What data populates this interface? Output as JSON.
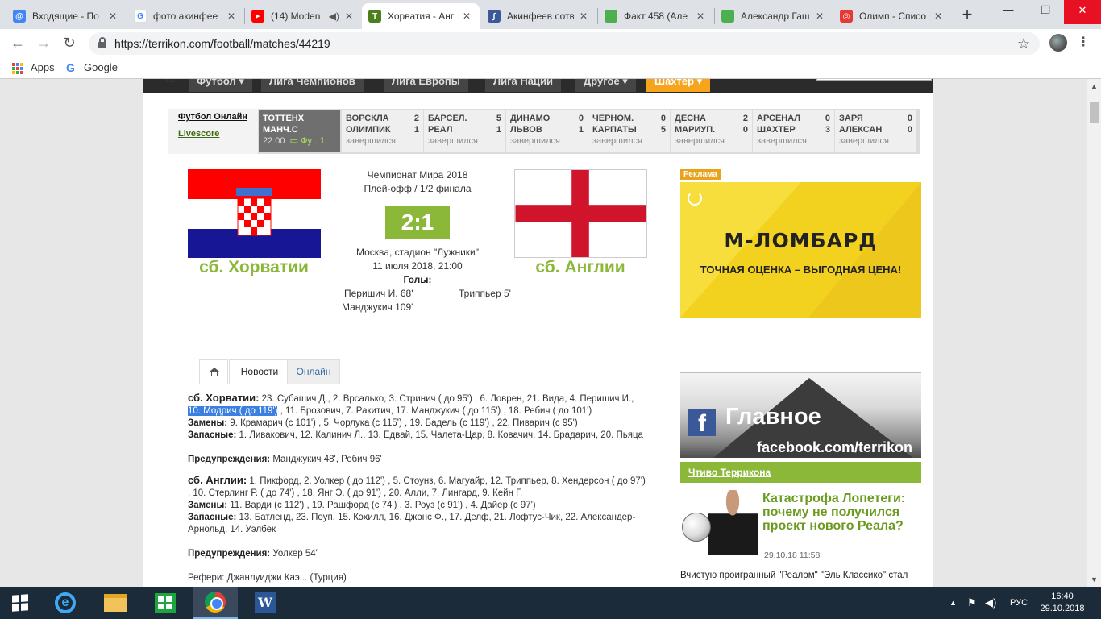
{
  "browser": {
    "tabs": [
      {
        "title": "Входящие - По",
        "icon_color": "#4285f4",
        "icon_char": "@"
      },
      {
        "title": "фото акинфее",
        "icon_color": "#ffffff",
        "icon_char": "G"
      },
      {
        "title": "(14) Moden",
        "icon_color": "#ff0000",
        "icon_char": "▶"
      },
      {
        "title": "Хорватия - Анг",
        "icon_color": "#4d7f1d",
        "icon_char": "T"
      },
      {
        "title": "Акинфеев сотв",
        "icon_color": "#3b5998",
        "icon_char": "∫"
      },
      {
        "title": "Факт 458 (Але",
        "icon_color": "#4caf50",
        "icon_char": ""
      },
      {
        "title": "Александр Гаш",
        "icon_color": "#4caf50",
        "icon_char": ""
      },
      {
        "title": "Олимп - Списо",
        "icon_color": "#e53935",
        "icon_char": "◎"
      }
    ],
    "url": "https://terrikon.com/football/matches/44219",
    "bookmarks": {
      "apps": "Apps",
      "google": "Google"
    }
  },
  "site": {
    "nav": [
      "Футбол ▾",
      "Лига Чемпионов",
      "Лига Европы",
      "Лига Наций",
      "Другое ▾",
      "Шахтер ▾"
    ]
  },
  "ticker": {
    "links": {
      "football_online": "Футбол Онлайн",
      "livescore": "Livescore"
    },
    "matches": [
      {
        "home": "ТОТТЕНХ",
        "away": "МАНЧ.С",
        "hs": "",
        "as": "",
        "status": "22:00",
        "live": "Фут. 1"
      },
      {
        "home": "ВОРСКЛА",
        "away": "ОЛИМПИК",
        "hs": "2",
        "as": "1",
        "status": "завершился",
        "live": ""
      },
      {
        "home": "БАРСЕЛ.",
        "away": "РЕАЛ",
        "hs": "5",
        "as": "1",
        "status": "завершился",
        "live": ""
      },
      {
        "home": "ДИНАМО",
        "away": "ЛЬВОВ",
        "hs": "0",
        "as": "1",
        "status": "завершился",
        "live": ""
      },
      {
        "home": "ЧЕРНОМ.",
        "away": "КАРПАТЫ",
        "hs": "0",
        "as": "5",
        "status": "завершился",
        "live": ""
      },
      {
        "home": "ДЕСНА",
        "away": "МАРИУП.",
        "hs": "2",
        "as": "0",
        "status": "завершился",
        "live": ""
      },
      {
        "home": "АРСЕНАЛ",
        "away": "ШАХТЕР",
        "hs": "0",
        "as": "3",
        "status": "завершился",
        "live": ""
      },
      {
        "home": "ЗАРЯ",
        "away": "АЛЕКСАН",
        "hs": "0",
        "as": "0",
        "status": "завершился",
        "live": ""
      }
    ]
  },
  "match": {
    "tournament": "Чемпионат Мира 2018",
    "stage": "Плей-офф / 1/2 финала",
    "score": "2:1",
    "venue": "Москва, стадион \"Лужники\"",
    "datetime": "11 июля 2018, 21:00",
    "goals_label": "Голы:",
    "home_team": "сб. Хорватии",
    "away_team": "сб. Англии",
    "home_goals": [
      "Перишич И. 68'",
      "Манджукич 109'"
    ],
    "away_goals": [
      "Триппьер 5'"
    ]
  },
  "tabs": {
    "news": "Новости",
    "online": "Онлайн"
  },
  "lineups": {
    "home_team": "сб. Хорватии:",
    "home_lineup_a": " 23. Субашич Д., 2. Врсалько, 3. Стринич ( до 95') , 6. Ловрен, 21. Вида, 4. Перишич И., ",
    "home_lineup_hl": "10. Модрич ( до 119')",
    "home_lineup_b": " , 11. Брозович, 7. Ракитич, 17. Манджукич ( до 115') , 18. Ребич ( до 101')",
    "subs_label": "Замены:",
    "home_subs": " 9. Крамарич (с 101') , 5. Чорлука (с 115') , 19. Бадель (с 119') , 22. Пиварич (с 95')",
    "reserve_label": "Запасные:",
    "home_reserve": " 1. Ливакович, 12. Калинич Л., 13. Едвай, 15. Чалета-Цар, 8. Ковачич, 14. Брадарич, 20. Пьяца",
    "warn_label": "Предупреждения:",
    "home_warn": " Манджукич 48', Ребич 96'",
    "away_team": "сб. Англии:",
    "away_lineup": " 1. Пикфорд, 2. Уолкер ( до 112') , 5. Стоунз, 6. Магуайр, 12. Триппьер, 8. Хендерсон ( до 97') , 10. Стерлинг Р. ( до 74') , 18. Янг Э. ( до 91') , 20. Алли, 7. Лингард, 9. Кейн Г.",
    "away_subs": " 11. Варди (с 112') , 19. Рашфорд (с 74') , 3. Роуз (с 91') , 4. Дайер (с 97')",
    "away_reserve": " 13. Батленд, 23. Поуп, 15. Кэхилл, 16. Джонс Ф., 17. Делф, 21. Лофтус-Чик, 22. Александер-Арнольд, 14. Уэлбек",
    "away_warn": " Уолкер 54'",
    "referee_cut": "Рефери: Джанлуиджи Каэ... (Турция)"
  },
  "sidebar": {
    "ad_label": "Реклама",
    "ad_brand": "М-ЛОМБАРД",
    "ad_slogan": "ТОЧНАЯ ОЦЕНКА – ВЫГОДНАЯ ЦЕНА!",
    "fb_title": "Главное",
    "fb_url": "facebook.com/terrikon",
    "reads_header": "Чтиво Террикона",
    "article_title": "Катастрофа Лопетеги: почему не получился проект нового Реала?",
    "article_date": "29.10.18 11:58",
    "article_teaser": "Вчистую проигранный \"Реалом\" \"Эль Классико\" стал"
  },
  "taskbar": {
    "lang": "РУС",
    "time": "16:40",
    "date": "29.10.2018"
  }
}
